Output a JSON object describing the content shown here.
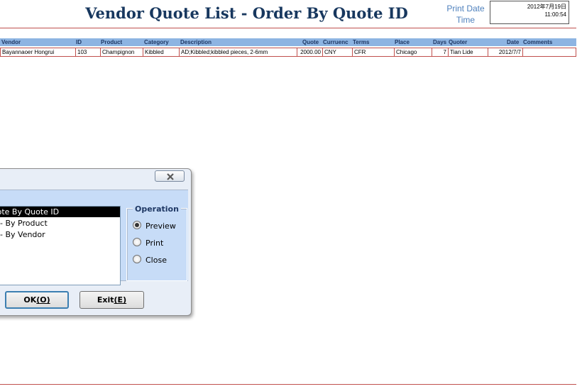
{
  "report": {
    "title": "Vendor Quote List - Order By Quote ID",
    "print_date_label": "Print Date",
    "time_label": "Time",
    "print_date": "2012年7月19日",
    "print_time": "11:00:54"
  },
  "table": {
    "columns": [
      "Vendor",
      "ID",
      "Product",
      "Category",
      "Description",
      "Quote",
      "Curruenc",
      "Terms",
      "Place",
      "Days",
      "Quoter",
      "Date",
      "Comments"
    ],
    "rows": [
      {
        "vendor": "Bayannaoer Hongrui",
        "id": "103",
        "product": "Champignon",
        "category": "Kibbled",
        "description": "AD;Kibbled;kibbled pieces, 2-6mm",
        "quote": "2000.00",
        "currency": "CNY",
        "terms": "CFR",
        "place": "Chicago",
        "days": "7",
        "quoter": "Tian Lide",
        "date": "2012/7/7",
        "comments": ""
      }
    ]
  },
  "dialog": {
    "list_items": [
      "Quote By Quote ID",
      "- By Product",
      "- By Vendor"
    ],
    "selected_index": 0,
    "operation": {
      "label": "Operation",
      "options": [
        "Preview",
        "Print",
        "Close"
      ],
      "selected": "Preview"
    },
    "ok_button": {
      "text": "OK",
      "accel": "(O)",
      "accel_key": "O"
    },
    "exit_button": {
      "text": "Exit",
      "accel": "(E)",
      "accel_key": "E"
    },
    "close_icon": "close-icon"
  },
  "colors": {
    "title": "#17375e",
    "header_fill": "#8db4e2",
    "rule": "#c0504d",
    "dialog_client": "#c7dcf7"
  }
}
